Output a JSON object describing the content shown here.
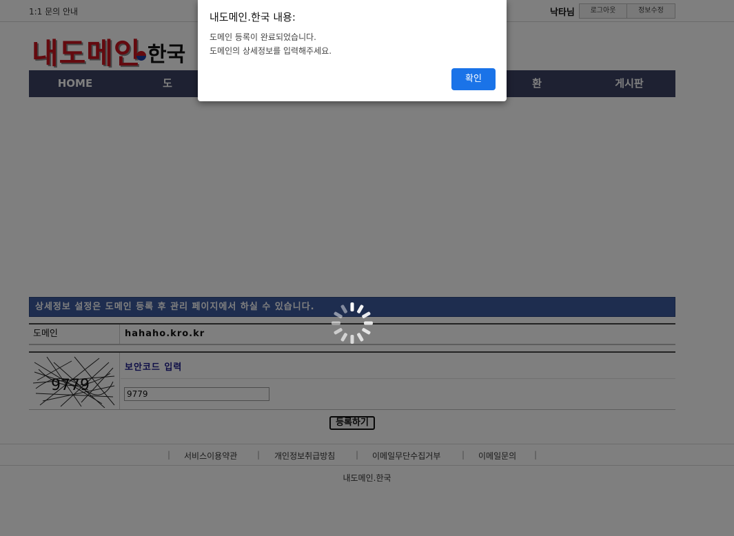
{
  "topbar": {
    "inquiry": "1:1 문의 안내",
    "user": "낙타님",
    "logout": "로그아웃",
    "edit_info": "정보수정"
  },
  "logo": {
    "main": "내도메인",
    "sub": "한국"
  },
  "nav": {
    "items": [
      "HOME",
      "도",
      "",
      "",
      "",
      "환",
      "게시판"
    ]
  },
  "notice": "상세정보 설정은 도메인 등록 후 관리 페이지에서 하실 수 있습니다.",
  "domain": {
    "label": "도메인",
    "value": "hahaho.kro.kr"
  },
  "captcha": {
    "image_text": "9779",
    "title": "보안코드 입력",
    "input_value": "9779"
  },
  "submit": "등록하기",
  "footer": {
    "links": [
      "서비스이용약관",
      "개인정보취급방침",
      "이메일무단수집거부",
      "이메일문의"
    ],
    "separator": "|",
    "copyright": "내도메인.한국"
  },
  "dialog": {
    "title": "내도메인.한국 내용:",
    "message_line1": "도메인 등록이 완료되었습니다.",
    "message_line2": "도메인의 상세정보를 입력해주세요.",
    "ok": "확인"
  },
  "colors": {
    "nav_bg": "#3c4264",
    "notice_bg": "#3c5a9e",
    "ok_button": "#1a73e8",
    "logo_red": "#c8141e"
  }
}
